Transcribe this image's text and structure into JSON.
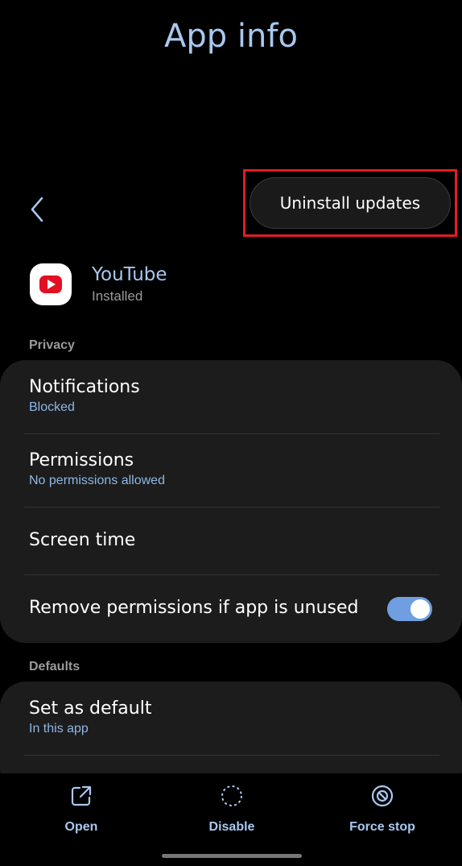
{
  "header": {
    "title": "App info"
  },
  "actions": {
    "uninstall_updates": "Uninstall updates"
  },
  "app": {
    "name": "YouTube",
    "status": "Installed"
  },
  "sections": {
    "privacy": {
      "label": "Privacy",
      "items": [
        {
          "title": "Notifications",
          "subtitle": "Blocked"
        },
        {
          "title": "Permissions",
          "subtitle": "No permissions allowed"
        },
        {
          "title": "Screen time"
        },
        {
          "title": "Remove permissions if app is unused",
          "toggle_on": true
        }
      ]
    },
    "defaults": {
      "label": "Defaults",
      "items": [
        {
          "title": "Set as default",
          "subtitle": "In this app"
        }
      ]
    }
  },
  "bottom_actions": [
    {
      "label": "Open",
      "icon": "open-external-icon"
    },
    {
      "label": "Disable",
      "icon": "disable-icon"
    },
    {
      "label": "Force stop",
      "icon": "force-stop-icon"
    }
  ],
  "colors": {
    "accent": "#a9c8ef",
    "subtitle": "#8fb6e6",
    "highlight": "#e11d22",
    "toggle_on": "#6f9fe0",
    "card_bg": "#1c1c1c"
  }
}
